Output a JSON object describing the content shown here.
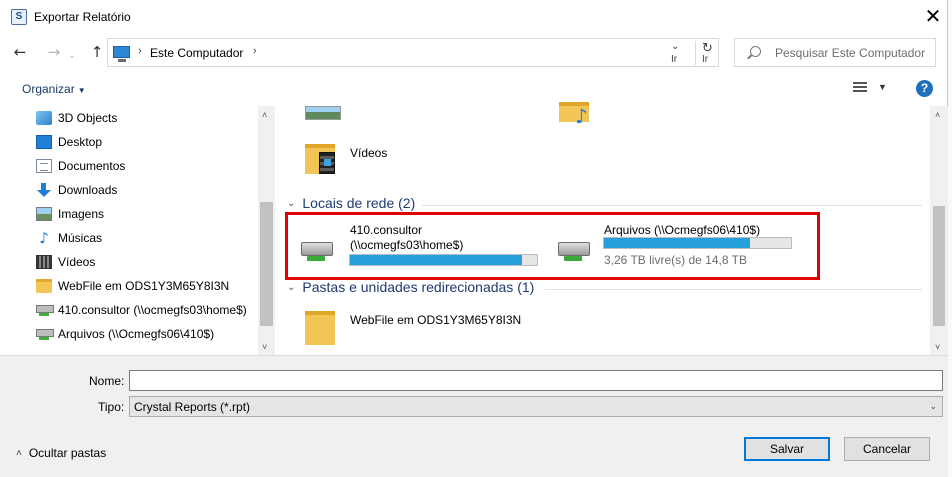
{
  "window": {
    "title": "Exportar Relatório",
    "close_symbol": "✕",
    "app_icon": "crystal-reports-icon"
  },
  "nav": {
    "back_symbol": "←",
    "forward_symbol": "→",
    "history_symbol": "⌄",
    "up_symbol": "↑",
    "address_sep": "›",
    "address_location": "Este Computador",
    "address_dropdown_symbol": "⌄",
    "address_dropdown_label": "Ir",
    "refresh_symbol": "↻",
    "refresh_label": "Ir",
    "search_placeholder": "Pesquisar Este Computador"
  },
  "toolbar": {
    "organize_label": "Organizar",
    "organize_caret": "▼",
    "view_dropdown_caret": "▼",
    "help_symbol": "?"
  },
  "sidebar": {
    "items": [
      {
        "label": "3D Objects",
        "icon": "3d-objects-icon"
      },
      {
        "label": "Desktop",
        "icon": "desktop-icon"
      },
      {
        "label": "Documentos",
        "icon": "documents-icon"
      },
      {
        "label": "Downloads",
        "icon": "downloads-icon"
      },
      {
        "label": "Imagens",
        "icon": "pictures-icon"
      },
      {
        "label": "Músicas",
        "icon": "music-icon"
      },
      {
        "label": "Vídeos",
        "icon": "videos-icon"
      },
      {
        "label": "WebFile em ODS1Y3M65Y8I3N",
        "icon": "folder-icon"
      },
      {
        "label": "410.consultor (\\\\ocmegfs03\\home$)",
        "icon": "network-drive-icon"
      },
      {
        "label": "Arquivos (\\\\Ocmegfs06\\410$)",
        "icon": "network-drive-icon"
      }
    ],
    "scroll_up": "˄",
    "scroll_down": "˅",
    "music_glyph": "♪"
  },
  "content": {
    "folders": [
      {
        "label": "Vídeos",
        "icon": "videos-folder-icon"
      }
    ],
    "network_group": {
      "header": "Locais de rede (2)",
      "chevron": "⌄",
      "drives": [
        {
          "name_line1": "410.consultor",
          "name_line2": "(\\\\ocmegfs03\\home$)",
          "used_fraction": 0.92,
          "free_text": ""
        },
        {
          "name_line1": "Arquivos (\\\\Ocmegfs06\\410$)",
          "name_line2": "",
          "used_fraction": 0.78,
          "free_text": "3,26 TB livre(s) de 14,8 TB"
        }
      ]
    },
    "redirected_group": {
      "header": "Pastas e unidades redirecionadas (1)",
      "chevron": "⌄",
      "items": [
        {
          "label": "WebFile em ODS1Y3M65Y8I3N",
          "icon": "folder-icon"
        }
      ]
    },
    "highlight_color": "#e00000",
    "bar_color": "#26a0da"
  },
  "form": {
    "name_label": "Nome:",
    "name_value": "",
    "type_label": "Tipo:",
    "type_value": "Crystal Reports (*.rpt)",
    "type_dropdown_symbol": "⌄",
    "hide_folders_label": "Ocultar pastas",
    "hide_folders_chevron": "˄",
    "save_label": "Salvar",
    "cancel_label": "Cancelar"
  },
  "colors": {
    "accent": "#0078d7",
    "help_icon": "#1f6fc0",
    "link_text": "#1e3a75"
  }
}
